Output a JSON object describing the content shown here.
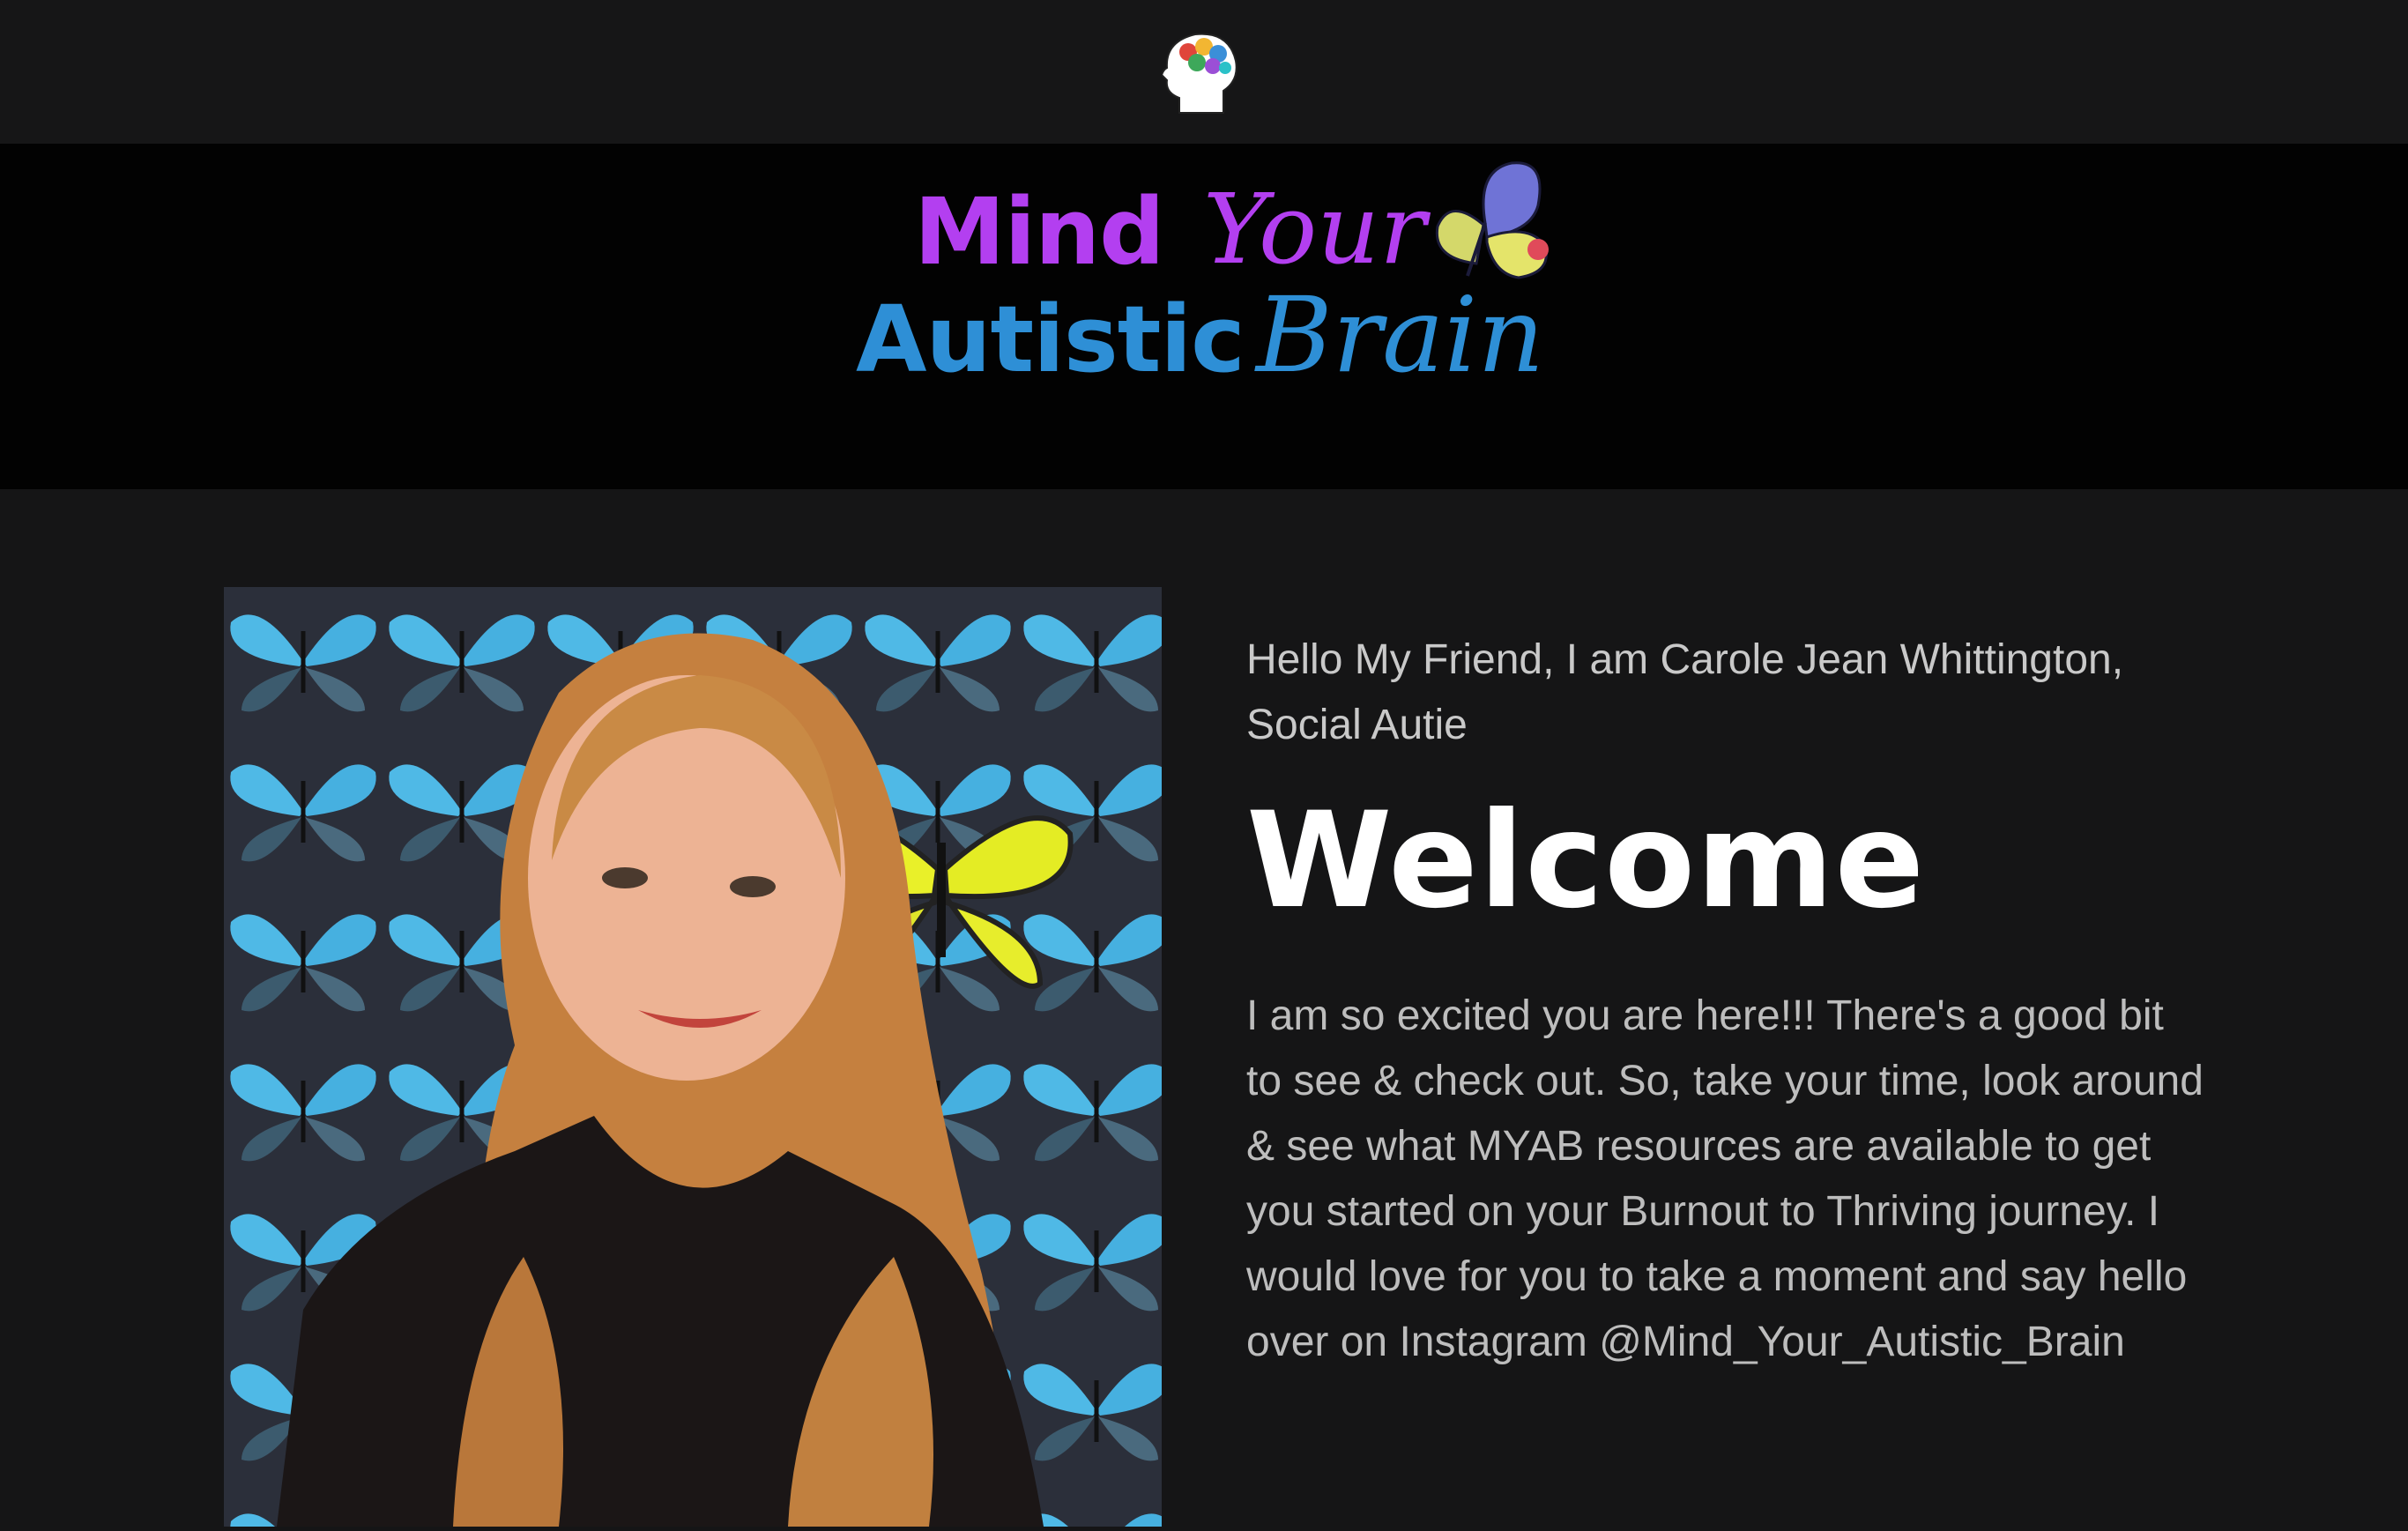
{
  "header": {
    "logo_icon": "head-brain-icon"
  },
  "banner": {
    "brand_line1_a": "Mind",
    "brand_line1_b": "Your",
    "brand_line2_a": "Autistic",
    "brand_line2_b": "Brain",
    "brand_icon": "butterfly-icon",
    "colors": {
      "purple": "#b33ff0",
      "blue": "#2e8fd6"
    }
  },
  "main": {
    "photo_subject": "portrait",
    "intro": "Hello My Friend, I am Carole Jean Whittington, Social Autie",
    "heading": "Welcome",
    "body": "I am so excited you are here!!!  There's a good bit to see & check out. So, take your time, look around & see what MYAB resources are available to get you started on your Burnout to Thriving journey. I would love for you to take a moment and say hello over on Instagram @Mind_Your_Autistic_Brain"
  }
}
